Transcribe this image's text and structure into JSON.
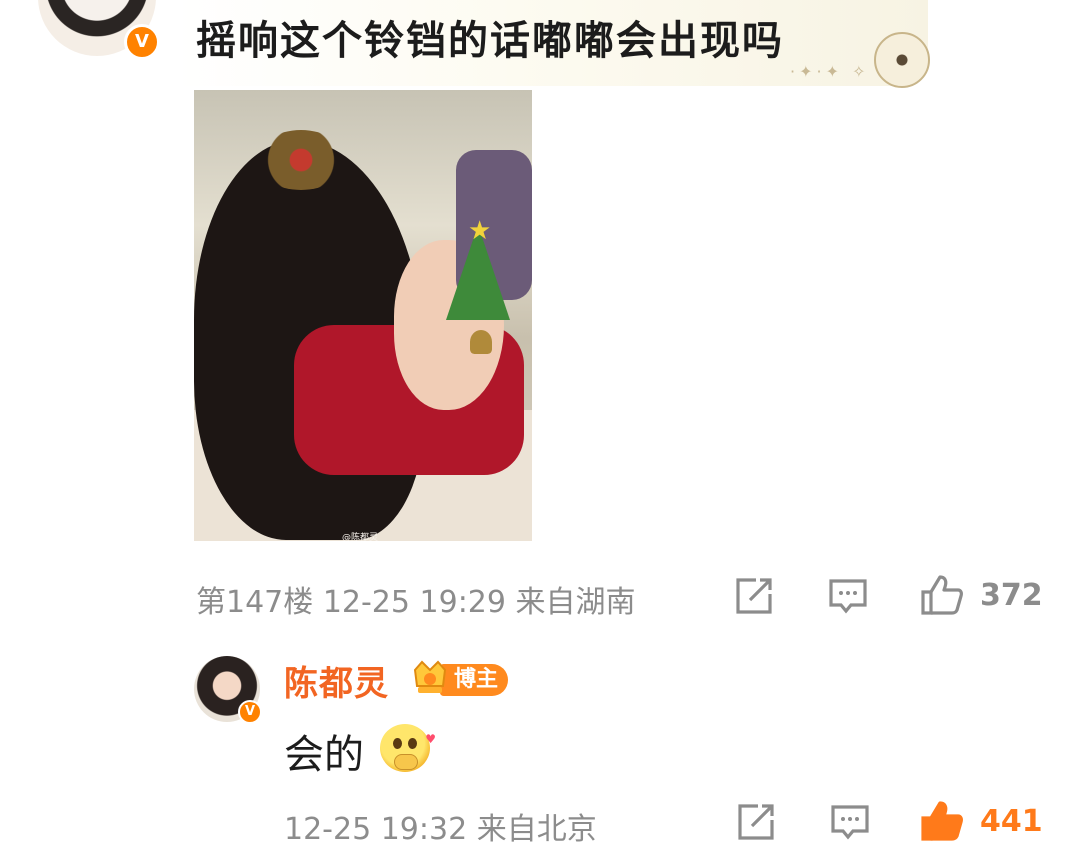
{
  "comment": {
    "text": "摇响这个铃铛的话嘟嘟会出现吗",
    "avatar_badge": "V",
    "floor": "第147楼",
    "time": "12-25 19:29",
    "location": "来自湖南",
    "like_count": "372",
    "photo_watermark": "@陈都灵"
  },
  "reply": {
    "name": "陈都灵",
    "badge_label": "博主",
    "avatar_badge": "V",
    "text": "会的",
    "time": "12-25 19:32",
    "location": "来自北京",
    "like_count": "441"
  },
  "icons": {
    "repost": "repost-icon",
    "comment": "comment-icon",
    "like": "like-icon",
    "verified": "verified-badge-icon",
    "crown": "crown-badge-icon",
    "compass": "compass-decoration-icon"
  },
  "colors": {
    "accent_orange": "#ff8200",
    "name_orange": "#f26522",
    "meta_gray": "#8c8c8c",
    "liked_orange": "#ff7a1a"
  }
}
